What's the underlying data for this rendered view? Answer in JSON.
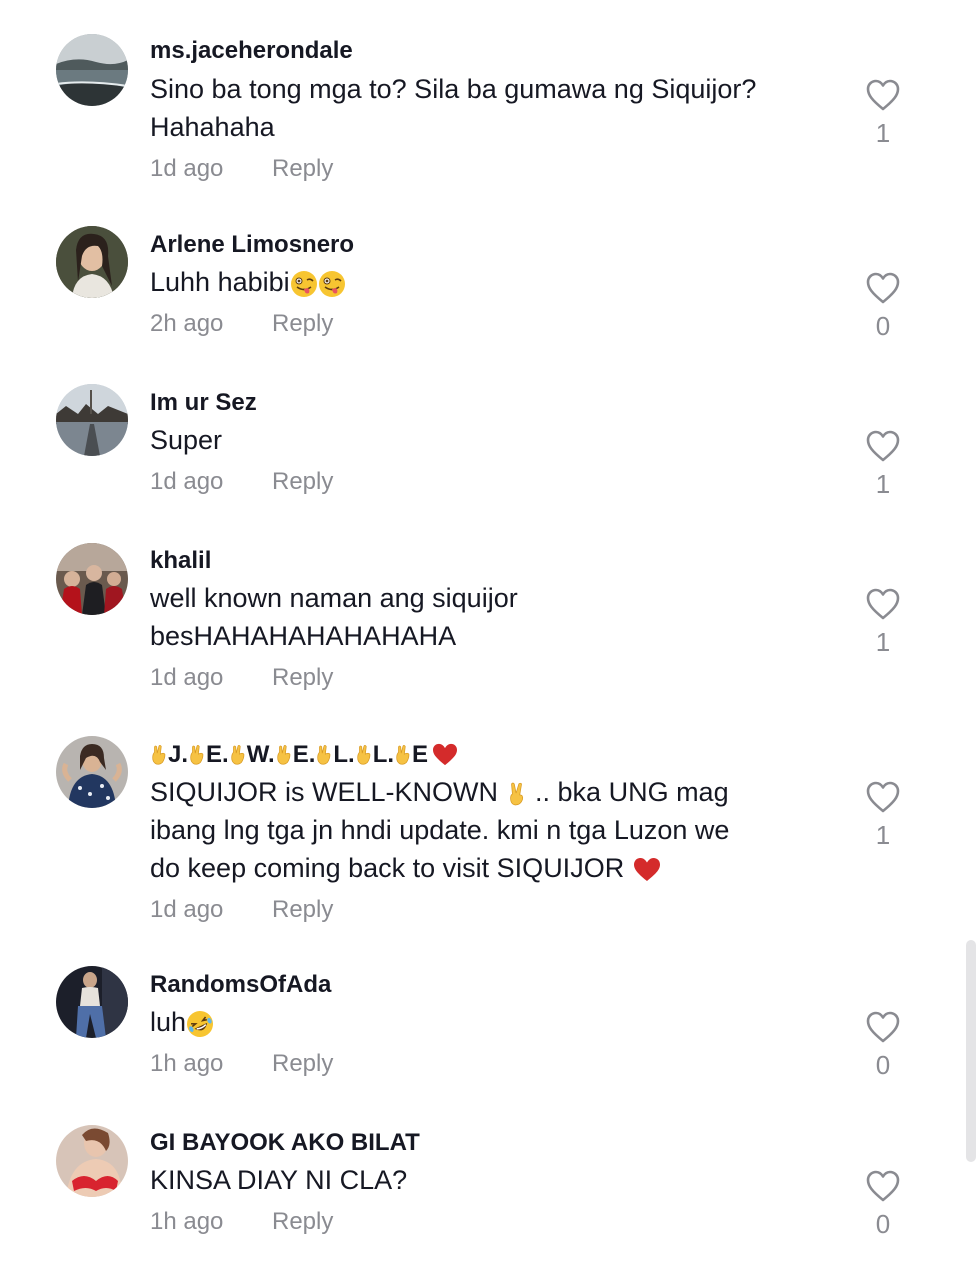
{
  "comments": [
    {
      "username": "ms.jaceherondale",
      "text_line1": "Sino ba tong mga to? Sila ba gumawa ng Siquijor?",
      "text_line2": "Hahahaha",
      "time": "1d ago",
      "reply": "Reply",
      "likes": "1"
    },
    {
      "username": "Arlene Limosnero",
      "text": "Luhh habibi",
      "time": "2h ago",
      "reply": "Reply",
      "likes": "0"
    },
    {
      "username": "Im ur Sez",
      "text": "Super",
      "time": "1d ago",
      "reply": "Reply",
      "likes": "1"
    },
    {
      "username": "khalil",
      "text_line1": "well known naman ang siquijor",
      "text_line2": "besHAHAHAHAHAHAHA",
      "time": "1d ago",
      "reply": "Reply",
      "likes": "1"
    },
    {
      "username_parts": [
        "J.",
        "E.",
        "W.",
        "E.",
        "L.",
        "L.",
        "E"
      ],
      "text_line1a": "SIQUIJOR is WELL-KNOWN ",
      "text_line1b": " .. bka UNG mag",
      "text_line2": "ibang lng tga jn hndi update. kmi n tga Luzon we",
      "text_line3": "do keep coming back to visit SIQUIJOR ",
      "time": "1d ago",
      "reply": "Reply",
      "likes": "1"
    },
    {
      "username": "RandomsOfAda",
      "text": "luh",
      "time": "1h ago",
      "reply": "Reply",
      "likes": "0"
    },
    {
      "username": "GI BAYOOK AKO BILAT",
      "text": "KINSA DIAY NI CLA?",
      "time": "1h ago",
      "reply": "Reply",
      "likes": "0"
    }
  ],
  "colors": {
    "primary_text": "#161823",
    "secondary_text": "#8a8b91",
    "heart_stroke": "#8a8b91",
    "heart_red": "#e0242f"
  },
  "icons": {
    "like": "heart-outline-icon",
    "emoji_tongue": "winking-tongue-emoji",
    "emoji_laugh": "rolling-laughing-emoji",
    "emoji_hand": "crossed-fingers-emoji",
    "emoji_peace": "victory-hand-emoji",
    "emoji_heart": "red-heart-emoji"
  }
}
